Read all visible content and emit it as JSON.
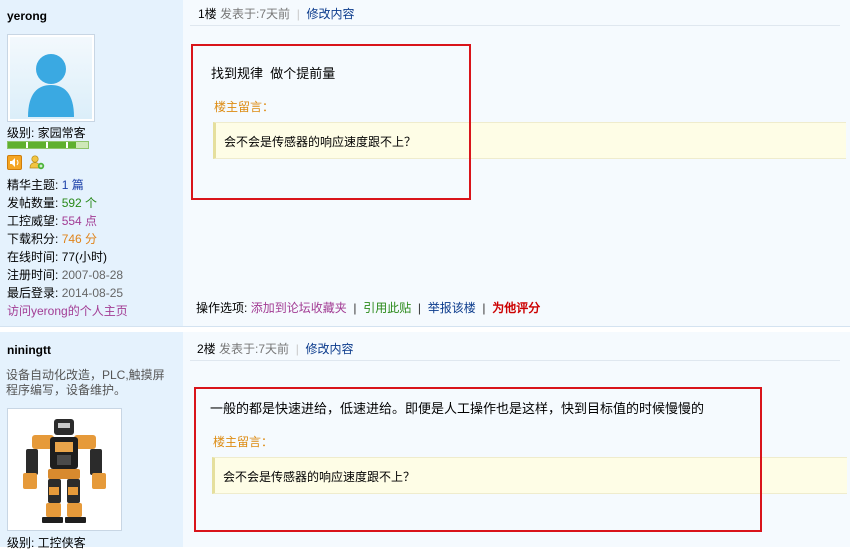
{
  "posts": [
    {
      "username": "yerong",
      "level": "级别: 家园常客",
      "stats": [
        {
          "label": "精华主题:",
          "value": "1 篇",
          "color": "#1a3fa8"
        },
        {
          "label": "发帖数量:",
          "value": "592 个",
          "color": "#2a8a1a"
        },
        {
          "label": "工控威望:",
          "value": "554 点",
          "color": "#a23c94"
        },
        {
          "label": "下载积分:",
          "value": "746 分",
          "color": "#e0841a"
        },
        {
          "label": "在线时间:",
          "value": "77(小时)",
          "color": "#000000"
        },
        {
          "label": "注册时间:",
          "value": "2007-08-28",
          "color": "#666666"
        },
        {
          "label": "最后登录:",
          "value": "2014-08-25",
          "color": "#666666"
        }
      ],
      "homepage_link": "访问yerong的个人主页",
      "floor": "1楼",
      "posted_label": "发表于:",
      "posted_time": "7天前",
      "edit_link": "修改内容",
      "content": "找到规律  做个提前量",
      "owner_comment_label": "楼主留言：",
      "owner_comment": "会不会是传感器的响应速度跟不上？",
      "actions_label": "操作选项:",
      "actions": [
        {
          "label": "添加到论坛收藏夹",
          "color": "#a23c94"
        },
        {
          "label": "引用此贴",
          "color": "#2a8a1a"
        },
        {
          "label": "举报该楼",
          "color": "#0a3a8c"
        },
        {
          "label": "为他评分",
          "color": "#cc0000"
        }
      ]
    },
    {
      "username": "niningtt",
      "signature": "设备自动化改造，PLC,触摸屏程序编写，设备维护。",
      "level": "级别: 工控侠客",
      "floor": "2楼",
      "posted_label": "发表于:",
      "posted_time": "7天前",
      "edit_link": "修改内容",
      "content": "一般的都是快速进给，低速进给。即便是人工操作也是这样，快到目标值的时候慢慢的",
      "owner_comment_label": "楼主留言：",
      "owner_comment": "会不会是传感器的响应速度跟不上？"
    }
  ],
  "icons": [
    "speaker-icon",
    "user-online-icon",
    "default-avatar-icon",
    "robot-avatar-image"
  ],
  "colors": {
    "sidebar_bg": "#e5f2fd",
    "post_bg": "#f5fafe",
    "annotation_red": "#d9141a",
    "quote_bg": "#fefde6",
    "owner_label": "#dd8b12"
  }
}
